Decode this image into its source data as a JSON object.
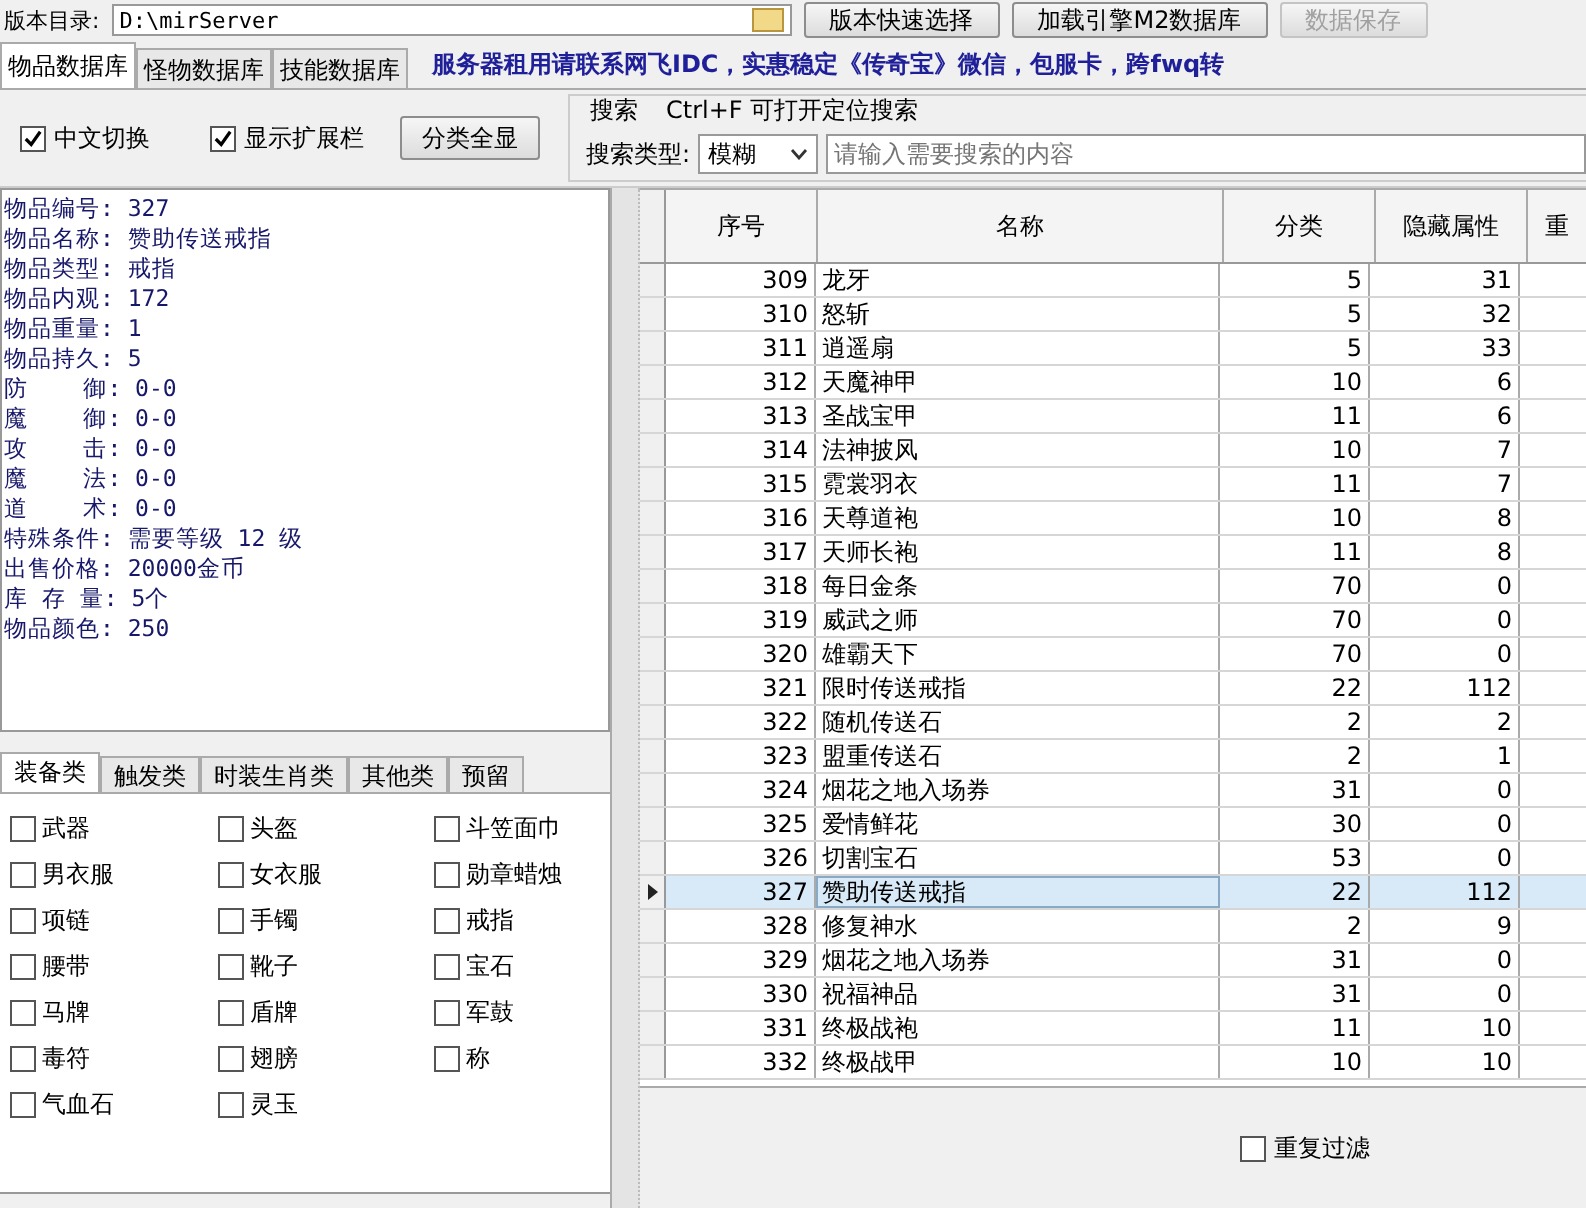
{
  "toolbar": {
    "path_label": "版本目录:",
    "path_value": "D:\\mirServer",
    "buttons": [
      {
        "label": "版本快速选择",
        "disabled": false
      },
      {
        "label": "加载引擎M2数据库",
        "disabled": false
      },
      {
        "label": "数据保存",
        "disabled": true
      }
    ]
  },
  "tabs": [
    {
      "label": "物品数据库",
      "selected": true
    },
    {
      "label": "怪物数据库",
      "selected": false
    },
    {
      "label": "技能数据库",
      "selected": false
    }
  ],
  "notices": [
    "服务器租用请联系网飞IDC，实惠稳定",
    "《传奇宝》微信，包服卡，跨fwq转"
  ],
  "options": [
    {
      "label": "中文切换",
      "checked": true
    },
    {
      "label": "显示扩展栏",
      "checked": true
    }
  ],
  "show_all_button": "分类全显",
  "search": {
    "title": "搜索",
    "hint": "Ctrl+F 可打开定位搜索",
    "type_label": "搜索类型:",
    "type_value": "模糊",
    "placeholder": "请输入需要搜索的内容"
  },
  "details": [
    "物品编号: 327",
    "物品名称: 赞助传送戒指",
    "物品类型: 戒指",
    "物品内观: 172",
    "物品重量: 1",
    "物品持久: 5",
    "防    御: 0-0",
    "魔    御: 0-0",
    "攻    击: 0-0",
    "魔    法: 0-0",
    "道    术: 0-0",
    "特殊条件: 需要等级 12 级",
    "出售价格: 20000金币",
    "库 存 量: 5个",
    "物品颜色: 250"
  ],
  "category_tabs": [
    {
      "label": "装备类",
      "selected": true
    },
    {
      "label": "触发类",
      "selected": false
    },
    {
      "label": "时装生肖类",
      "selected": false
    },
    {
      "label": "其他类",
      "selected": false
    },
    {
      "label": "预留",
      "selected": false
    }
  ],
  "categories": [
    {
      "label": "武器",
      "checked": false
    },
    {
      "label": "头盔",
      "checked": false
    },
    {
      "label": "斗笠面巾",
      "checked": false
    },
    {
      "label": "男衣服",
      "checked": false
    },
    {
      "label": "女衣服",
      "checked": false
    },
    {
      "label": "勋章蜡烛",
      "checked": false
    },
    {
      "label": "项链",
      "checked": false
    },
    {
      "label": "手镯",
      "checked": false
    },
    {
      "label": "戒指",
      "checked": false
    },
    {
      "label": "腰带",
      "checked": false
    },
    {
      "label": "靴子",
      "checked": false
    },
    {
      "label": "宝石",
      "checked": false
    },
    {
      "label": "马牌",
      "checked": false
    },
    {
      "label": "盾牌",
      "checked": false
    },
    {
      "label": "军鼓",
      "checked": false
    },
    {
      "label": "毒符",
      "checked": false
    },
    {
      "label": "翅膀",
      "checked": false
    },
    {
      "label": "称",
      "checked": false
    },
    {
      "label": "气血石",
      "checked": false
    },
    {
      "label": "灵玉",
      "checked": false
    }
  ],
  "table": {
    "columns": [
      "序号",
      "名称",
      "分类",
      "隐藏属性",
      "重"
    ],
    "rows": [
      {
        "cells": [
          "309",
          "龙牙",
          "5",
          "31"
        ],
        "selected": false
      },
      {
        "cells": [
          "310",
          "怒斩",
          "5",
          "32"
        ],
        "selected": false
      },
      {
        "cells": [
          "311",
          "逍遥扇",
          "5",
          "33"
        ],
        "selected": false
      },
      {
        "cells": [
          "312",
          "天魔神甲",
          "10",
          "6"
        ],
        "selected": false
      },
      {
        "cells": [
          "313",
          "圣战宝甲",
          "11",
          "6"
        ],
        "selected": false
      },
      {
        "cells": [
          "314",
          "法神披风",
          "10",
          "7"
        ],
        "selected": false
      },
      {
        "cells": [
          "315",
          "霓裳羽衣",
          "11",
          "7"
        ],
        "selected": false
      },
      {
        "cells": [
          "316",
          "天尊道袍",
          "10",
          "8"
        ],
        "selected": false
      },
      {
        "cells": [
          "317",
          "天师长袍",
          "11",
          "8"
        ],
        "selected": false
      },
      {
        "cells": [
          "318",
          "每日金条",
          "70",
          "0"
        ],
        "selected": false
      },
      {
        "cells": [
          "319",
          "威武之师",
          "70",
          "0"
        ],
        "selected": false
      },
      {
        "cells": [
          "320",
          "雄霸天下",
          "70",
          "0"
        ],
        "selected": false
      },
      {
        "cells": [
          "321",
          "限时传送戒指",
          "22",
          "112"
        ],
        "selected": false
      },
      {
        "cells": [
          "322",
          "随机传送石",
          "2",
          "2"
        ],
        "selected": false
      },
      {
        "cells": [
          "323",
          "盟重传送石",
          "2",
          "1"
        ],
        "selected": false
      },
      {
        "cells": [
          "324",
          "烟花之地入场券",
          "31",
          "0"
        ],
        "selected": false
      },
      {
        "cells": [
          "325",
          "爱情鲜花",
          "30",
          "0"
        ],
        "selected": false
      },
      {
        "cells": [
          "326",
          "切割宝石",
          "53",
          "0"
        ],
        "selected": false
      },
      {
        "cells": [
          "327",
          "赞助传送戒指",
          "22",
          "112"
        ],
        "selected": true
      },
      {
        "cells": [
          "328",
          "修复神水",
          "2",
          "9"
        ],
        "selected": false
      },
      {
        "cells": [
          "329",
          "烟花之地入场券",
          "31",
          "0"
        ],
        "selected": false
      },
      {
        "cells": [
          "330",
          "祝福神品",
          "31",
          "0"
        ],
        "selected": false
      },
      {
        "cells": [
          "331",
          "终极战袍",
          "11",
          "10"
        ],
        "selected": false
      },
      {
        "cells": [
          "332",
          "终极战甲",
          "10",
          "10"
        ],
        "selected": false
      }
    ]
  },
  "dedupe": {
    "label": "重复过滤",
    "checked": false
  }
}
